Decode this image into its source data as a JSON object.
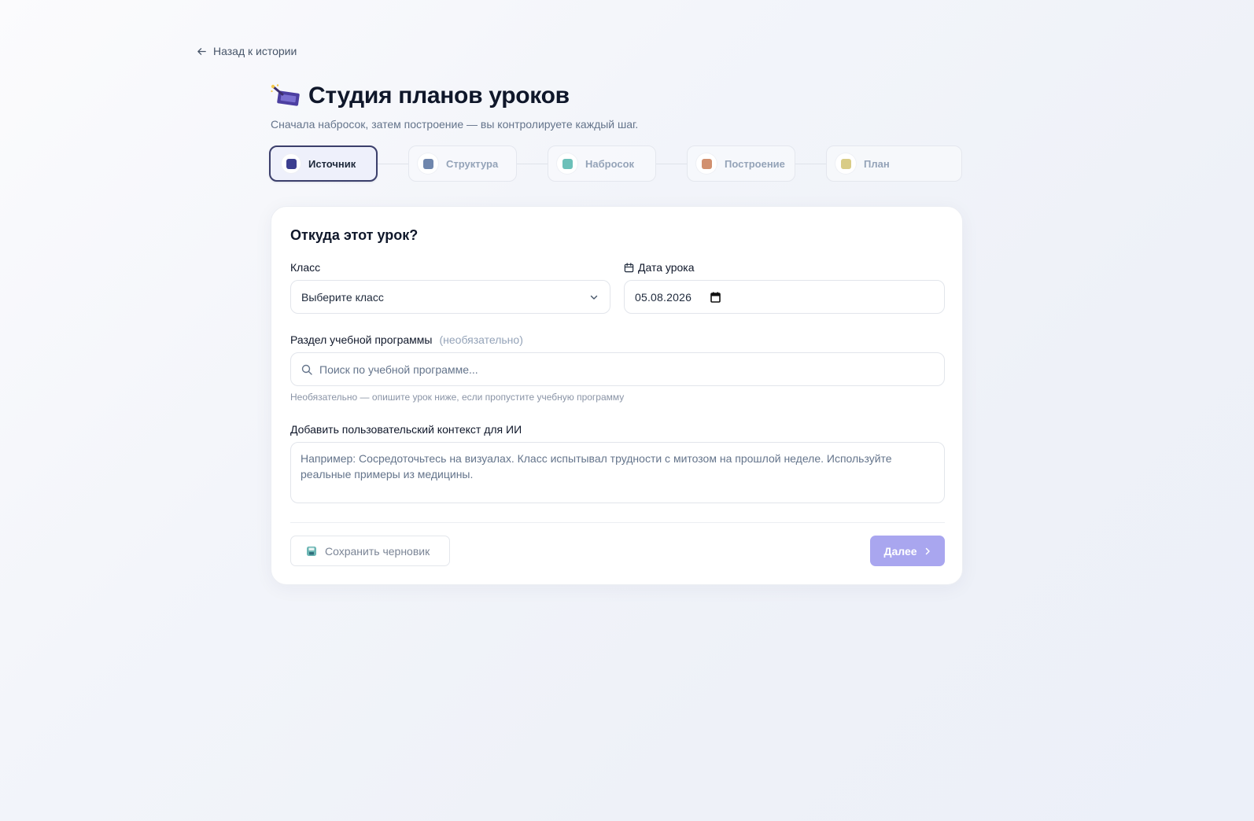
{
  "nav": {
    "back_label": "Назад к истории"
  },
  "header": {
    "title": "Студия планов уроков",
    "subtitle": "Сначала набросок, затем построение — вы контролируете каждый шаг."
  },
  "steps": [
    {
      "label": "Источник",
      "icon": "source-icon",
      "active": true,
      "color": "#3c3f8f"
    },
    {
      "label": "Структура",
      "icon": "structure-icon",
      "active": false,
      "color": "#6f86ad"
    },
    {
      "label": "Набросок",
      "icon": "draft-icon",
      "active": false,
      "color": "#6cc0b9"
    },
    {
      "label": "Построение",
      "icon": "build-icon",
      "active": false,
      "color": "#d1906f"
    },
    {
      "label": "План",
      "icon": "plan-icon",
      "active": false,
      "color": "#d9cc86"
    }
  ],
  "form": {
    "title": "Откуда этот урок?",
    "class_label": "Класс",
    "class_value": "Выберите класс",
    "date_label": "Дата урока",
    "date_value": "05.08.2026",
    "syllabus_label": "Раздел учебной программы",
    "syllabus_optional": "(необязательно)",
    "syllabus_placeholder": "Поиск по учебной программе...",
    "syllabus_hint": "Необязательно — опишите урок ниже, если пропустите учебную программу",
    "context_label": "Добавить пользовательский контекст для ИИ",
    "context_placeholder": "Например: Сосредоточьтесь на визуалах. Класс испытывал трудности с митозом на прошлой неделе. Используйте реальные примеры из медицины."
  },
  "actions": {
    "save_draft_label": "Сохранить черновик",
    "next_label": "Далее"
  },
  "colors": {
    "accent": "#a9a6ef",
    "active_step_border": "#3b3f6b",
    "title_text": "#0f172a"
  }
}
